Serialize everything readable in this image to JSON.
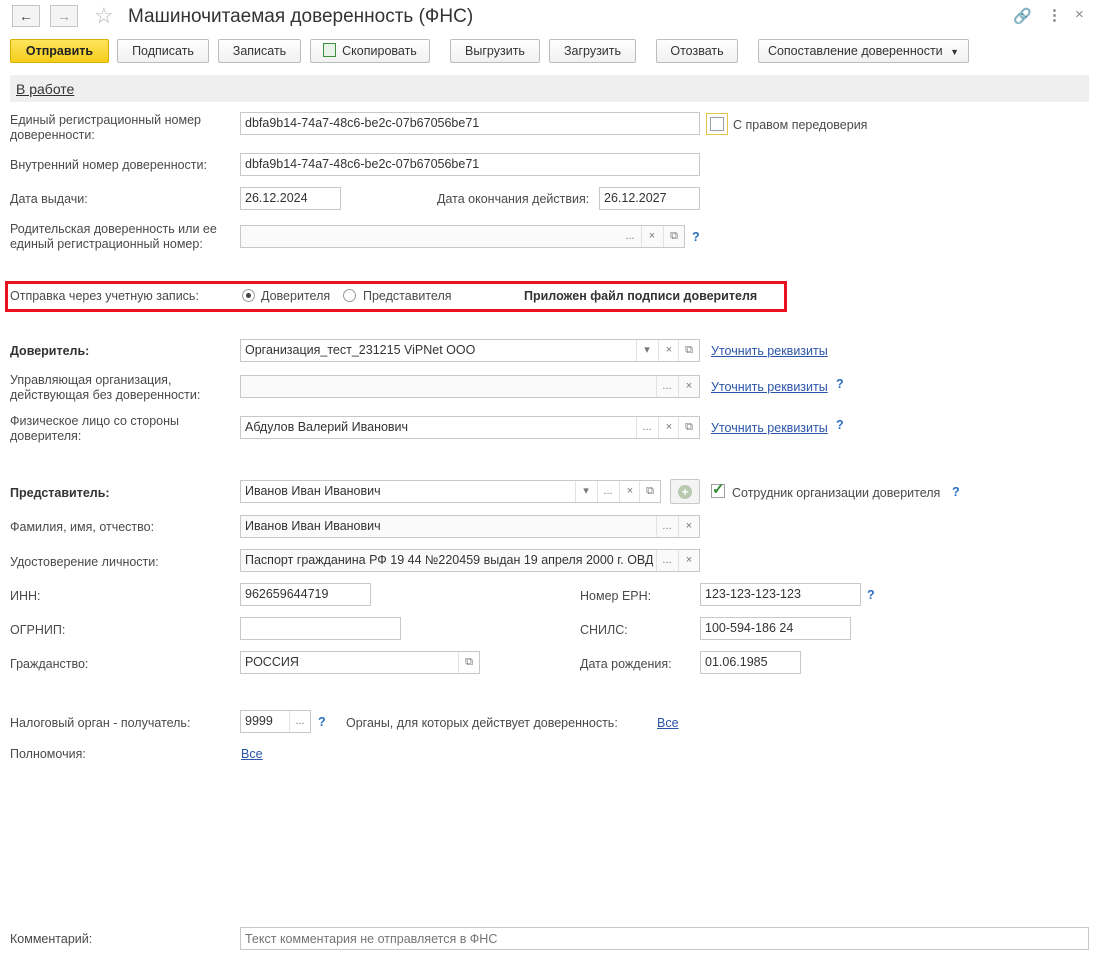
{
  "window": {
    "title": "Машиночитаемая доверенность (ФНС)"
  },
  "toolbar": {
    "send": "Отправить",
    "sign": "Подписать",
    "save": "Записать",
    "copy": "Скопировать",
    "export": "Выгрузить",
    "import": "Загрузить",
    "revoke": "Отозвать",
    "compare": "Сопоставление доверенности"
  },
  "status": {
    "label": "В работе"
  },
  "form": {
    "reg_number": {
      "label": "Единый регистрационный номер доверенности:",
      "value": "dbfa9b14-74a7-48c6-be2c-07b67056be71"
    },
    "redelegation": {
      "label": "С правом передоверия",
      "checked": false
    },
    "internal_number": {
      "label": "Внутренний номер доверенности:",
      "value": "dbfa9b14-74a7-48c6-be2c-07b67056be71"
    },
    "issue_date": {
      "label": "Дата выдачи:",
      "value": "26.12.2024"
    },
    "end_date": {
      "label": "Дата окончания действия:",
      "value": "26.12.2027"
    },
    "parent": {
      "label": "Родительская доверенность или ее единый регистрационный номер:",
      "value": ""
    },
    "send_via": {
      "label": "Отправка через учетную запись:",
      "options": [
        "Доверителя",
        "Представителя"
      ],
      "selected": "Доверителя",
      "note": "Приложен файл подписи доверителя",
      "highlight_color": "#e8111d"
    },
    "principal": {
      "label": "Доверитель:",
      "value": "Организация_тест_231215 ViPNet ООО",
      "link": "Уточнить реквизиты"
    },
    "managing_org": {
      "label": "Управляющая организация, действующая без доверенности:",
      "value": "",
      "link": "Уточнить реквизиты"
    },
    "principal_person": {
      "label": "Физическое лицо со стороны доверителя:",
      "value": "Абдулов Валерий Иванович",
      "link": "Уточнить реквизиты"
    },
    "representative": {
      "label": "Представитель:",
      "value": "Иванов Иван Иванович",
      "employee_label": "Сотрудник организации доверителя",
      "employee_checked": true
    },
    "fio": {
      "label": "Фамилия, имя, отчество:",
      "value": "Иванов Иван Иванович"
    },
    "identity_doc": {
      "label": "Удостоверение личности:",
      "value": "Паспорт гражданина РФ 19 44 №220459 выдан 19 апреля 2000 г. ОВД"
    },
    "inn": {
      "label": "ИНН:",
      "value": "962659644719"
    },
    "ern": {
      "label": "Номер ЕРН:",
      "value": "123-123-123-123"
    },
    "ogrnip": {
      "label": "ОГРНИП:",
      "value": ""
    },
    "snils": {
      "label": "СНИЛС:",
      "value": "100-594-186 24"
    },
    "citizenship": {
      "label": "Гражданство:",
      "value": "РОССИЯ"
    },
    "birth_date": {
      "label": "Дата рождения:",
      "value": "01.06.1985"
    },
    "tax_authority": {
      "label": "Налоговый орган - получатель:",
      "value": "9999"
    },
    "bodies": {
      "label": "Органы, для которых действует доверенность:",
      "link": "Все"
    },
    "powers": {
      "label": "Полномочия:",
      "link": "Все"
    },
    "comment": {
      "label": "Комментарий:",
      "placeholder": "Текст комментария не отправляется в ФНС"
    }
  },
  "common": {
    "help": "?",
    "ellipsis": "...",
    "clear": "×",
    "open": "⧉",
    "dropdown": "▾"
  }
}
